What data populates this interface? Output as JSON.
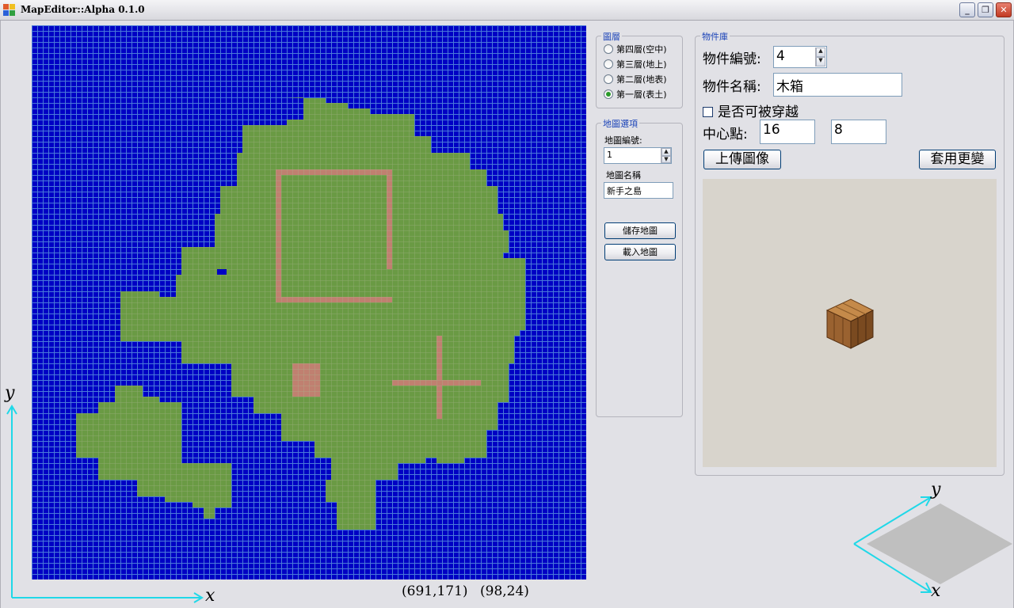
{
  "window": {
    "title": "MapEditor::Alpha 0.1.0",
    "buttons": {
      "minimize": "_",
      "restore": "❐",
      "close": "✕"
    }
  },
  "layers": {
    "title": "圖層",
    "items": [
      {
        "label": "第四層(空中)",
        "selected": false
      },
      {
        "label": "第三層(地上)",
        "selected": false
      },
      {
        "label": "第二層(地表)",
        "selected": false
      },
      {
        "label": "第一層(表土)",
        "selected": true
      }
    ]
  },
  "map_options": {
    "title": "地圖選項",
    "map_id_label": "地圖編號:",
    "map_id_value": "1",
    "map_name_label": "地圖名稱",
    "map_name_value": "新手之島",
    "save_label": "儲存地圖",
    "load_label": "載入地圖"
  },
  "library": {
    "title": "物件庫",
    "object_id_label": "物件編號:",
    "object_id_value": "4",
    "object_name_label": "物件名稱:",
    "object_name_value": "木箱",
    "passable_label": "是否可被穿越",
    "passable_checked": false,
    "center_label": "中心點:",
    "center_x": "16",
    "center_y": "8",
    "upload_label": "上傳圖像",
    "apply_label": "套用更變"
  },
  "status": {
    "pixel_coord": "(691,171)",
    "tile_coord": "(98,24)"
  },
  "axes": {
    "y": "y",
    "x": "x"
  },
  "colors": {
    "water": "#0000c4",
    "grass": "#6a9a44",
    "dirt": "#c08070",
    "group_title": "#1c44b8"
  },
  "icons": {
    "app": "map-editor-icon",
    "crate": "wooden-crate-icon",
    "spin_up": "arrow-up-icon",
    "spin_down": "arrow-down-icon"
  }
}
